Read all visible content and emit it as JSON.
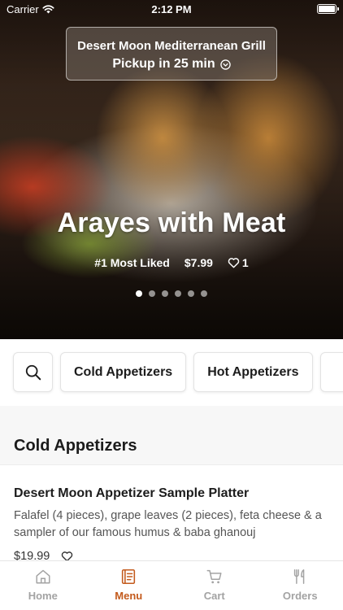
{
  "status_bar": {
    "carrier": "Carrier",
    "time": "2:12 PM"
  },
  "restaurant": {
    "name": "Desert Moon Mediterranean Grill",
    "pickup": "Pickup in 25 min"
  },
  "featured": {
    "title": "Arayes with Meat",
    "badge": "#1 Most Liked",
    "price": "$7.99",
    "likes": "1",
    "slide_count": 6,
    "active_slide": 1
  },
  "categories": {
    "search_icon": "search-icon",
    "items": [
      "Cold Appetizers",
      "Hot Appetizers"
    ]
  },
  "section": {
    "title": "Cold Appetizers"
  },
  "menu_items": [
    {
      "name": "Desert Moon Appetizer Sample Platter",
      "description": "Falafel (4 pieces), grape leaves (2 pieces), feta cheese & a sampler of our famous humus & baba ghanouj",
      "price": "$19.99"
    }
  ],
  "tabs": [
    {
      "label": "Home",
      "icon": "home-icon",
      "active": false
    },
    {
      "label": "Menu",
      "icon": "menu-icon",
      "active": true
    },
    {
      "label": "Cart",
      "icon": "cart-icon",
      "active": false
    },
    {
      "label": "Orders",
      "icon": "orders-icon",
      "active": false
    }
  ],
  "colors": {
    "accent": "#c35a1c",
    "inactive_tab": "#a3a3a3"
  }
}
